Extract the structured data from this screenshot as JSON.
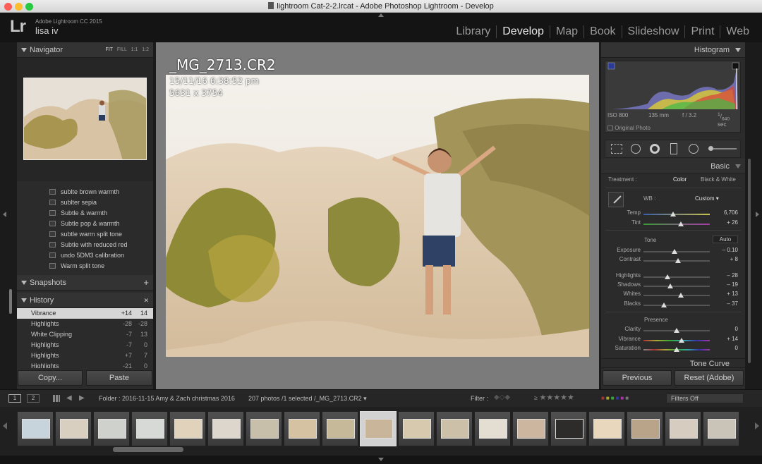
{
  "window": {
    "title": "lightroom Cat-2-2.lrcat - Adobe Photoshop Lightroom - Develop"
  },
  "identity": {
    "logo": "Lr",
    "product": "Adobe Lightroom CC 2015",
    "user": "lisa iv"
  },
  "modules": [
    "Library",
    "Develop",
    "Map",
    "Book",
    "Slideshow",
    "Print",
    "Web"
  ],
  "active_module": "Develop",
  "navigator": {
    "title": "Navigator",
    "zoom": [
      "FIT",
      "FILL",
      "1:1",
      "1:2"
    ]
  },
  "presets": [
    "sublte brown warmth",
    "sublter sepia",
    "Subtle & warmth",
    "Subtle pop & warmth",
    "subtle warm split tone",
    "Subtle with reduced red",
    "undo 5DM3 calibration",
    "Warm split tone"
  ],
  "snapshots": {
    "title": "Snapshots",
    "add": "+"
  },
  "history": {
    "title": "History",
    "clear": "✕",
    "items": [
      {
        "label": "Vibrance",
        "a": "+14",
        "b": "14"
      },
      {
        "label": "Highlights",
        "a": "-28",
        "b": "-28"
      },
      {
        "label": "White Clipping",
        "a": "-7",
        "b": "13"
      },
      {
        "label": "Highlights",
        "a": "-7",
        "b": "0"
      },
      {
        "label": "Highlights",
        "a": "+7",
        "b": "7"
      },
      {
        "label": "Highlights",
        "a": "-21",
        "b": "0"
      }
    ]
  },
  "left_buttons": {
    "copy": "Copy...",
    "paste": "Paste"
  },
  "photo_info": {
    "filename": "_MG_2713.CR2",
    "datetime": "15/11/16 6:38:52 pm",
    "dimensions": "5631 x 3754"
  },
  "histogram": {
    "title": "Histogram",
    "iso": "ISO 800",
    "focal": "135 mm",
    "aperture": "f / 3.2",
    "shutter_num": "1",
    "shutter_den": "640",
    "shutter_unit": "sec",
    "original": "Original Photo"
  },
  "basic": {
    "title": "Basic",
    "treatment_label": "Treatment :",
    "color": "Color",
    "bw": "Black & White",
    "wb_label": "WB :",
    "wb_value": "Custom",
    "tone_label": "Tone",
    "auto": "Auto",
    "presence_label": "Presence",
    "sliders": [
      {
        "label": "Temp",
        "value": "6,706",
        "pos": 0.45
      },
      {
        "label": "Tint",
        "value": "+ 26",
        "pos": 0.56
      },
      {
        "label": "Exposure",
        "value": "– 0.10",
        "pos": 0.47
      },
      {
        "label": "Contrast",
        "value": "+ 8",
        "pos": 0.52
      },
      {
        "label": "Highlights",
        "value": "– 28",
        "pos": 0.36
      },
      {
        "label": "Shadows",
        "value": "– 19",
        "pos": 0.4
      },
      {
        "label": "Whites",
        "value": "+ 13",
        "pos": 0.56
      },
      {
        "label": "Blacks",
        "value": "– 37",
        "pos": 0.31
      },
      {
        "label": "Clarity",
        "value": "0",
        "pos": 0.5
      },
      {
        "label": "Vibrance",
        "value": "+ 14",
        "pos": 0.57
      },
      {
        "label": "Saturation",
        "value": "0",
        "pos": 0.5
      }
    ],
    "tone_curve": "Tone Curve"
  },
  "right_buttons": {
    "previous": "Previous",
    "reset": "Reset (Adobe)"
  },
  "toolbar": {
    "view1": "1",
    "view2": "2",
    "folder": "Folder : 2016-11-15 Amy & Zach christmas 2016",
    "count": "207 photos /1 selected /_MG_2713.CR2",
    "filter_label": "Filter :",
    "filters_off": "Filters Off"
  },
  "colors": {
    "accent": "#e8e8e8",
    "panel": "#2b2b2b",
    "canvas": "#7b7b7b"
  },
  "filmstrip_count": 19,
  "filmstrip_selected": 9
}
